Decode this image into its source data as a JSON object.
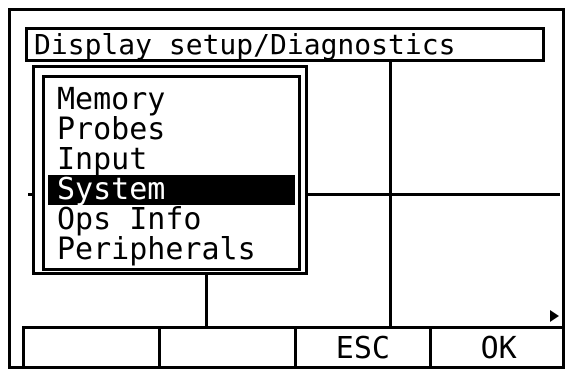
{
  "title": "Display setup/Diagnostics",
  "menu": {
    "items": [
      {
        "label": "Memory",
        "selected": false
      },
      {
        "label": "Probes",
        "selected": false
      },
      {
        "label": "Input",
        "selected": false
      },
      {
        "label": "System",
        "selected": true
      },
      {
        "label": "Ops Info",
        "selected": false
      },
      {
        "label": "Peripherals",
        "selected": false
      }
    ]
  },
  "softkeys": [
    "",
    "",
    "ESC",
    "OK"
  ],
  "colors": {
    "foreground": "#000000",
    "background": "#ffffff",
    "highlight": "#000000"
  }
}
